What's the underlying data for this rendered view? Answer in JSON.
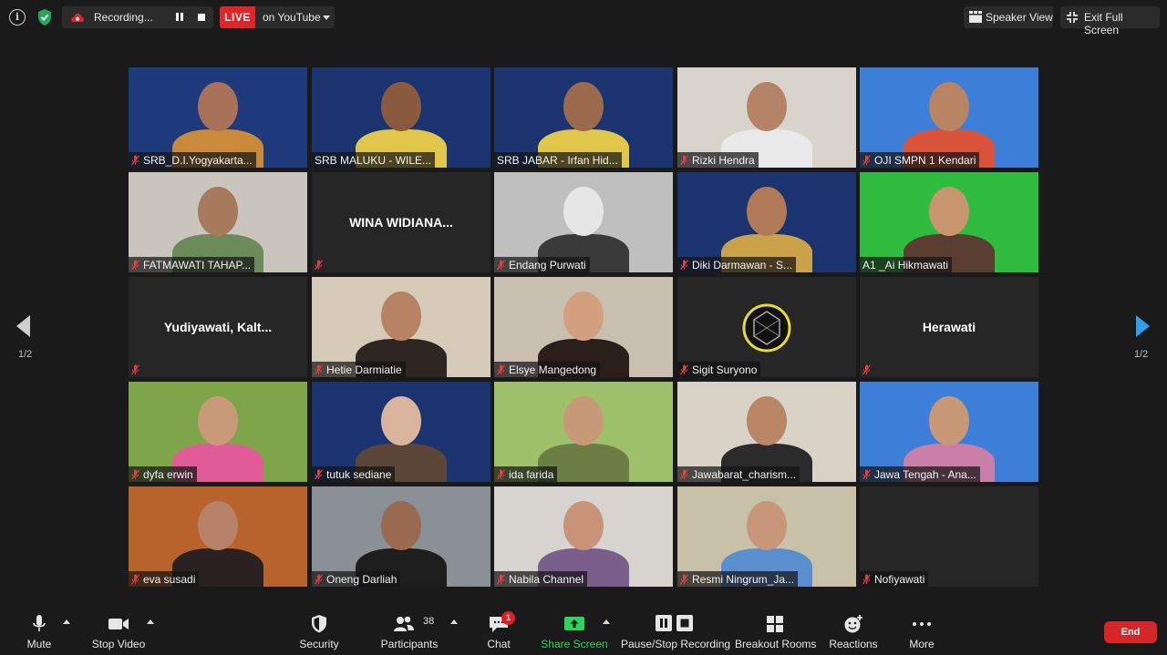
{
  "topbar": {
    "recording_label": "Recording...",
    "live_label": "LIVE",
    "stream_target": "on YouTube",
    "speaker_view_label": "Speaker View",
    "exit_fullscreen_label": "Exit Full Screen"
  },
  "pagination": {
    "left_indicator": "1/2",
    "right_indicator": "1/2"
  },
  "participants": [
    {
      "name": "SRB_D.I.Yogyakarta...",
      "type": "video",
      "bg": "#1e3a7a",
      "skin": "#a8725a",
      "shirt": "#c98a3b",
      "muted": true
    },
    {
      "name": "SRB MALUKU - WILE...",
      "type": "video",
      "bg": "#1b3470",
      "skin": "#8a5a3f",
      "shirt": "#e0c64a",
      "muted": false,
      "active": true
    },
    {
      "name": "SRB JABAR - Irfan Hid...",
      "type": "video",
      "bg": "#1b3470",
      "skin": "#9b6a4d",
      "shirt": "#e0c64a",
      "muted": false
    },
    {
      "name": "Rizki Hendra",
      "type": "video",
      "bg": "#d8d4cc",
      "skin": "#b58466",
      "shirt": "#e9e9ea",
      "muted": true
    },
    {
      "name": "OJI SMPN 1 Kendari",
      "type": "video",
      "bg": "#3d7fd8",
      "skin": "#b98464",
      "shirt": "#d9523a",
      "muted": true
    },
    {
      "name": "FATMAWATI TAHAP...",
      "type": "video",
      "bg": "#c9c5bd",
      "skin": "#a87a5d",
      "shirt": "#6c8a5a",
      "muted": true
    },
    {
      "name": "",
      "big_name": "WINA WIDIANA...",
      "type": "name",
      "muted": true
    },
    {
      "name": "Endang Purwati",
      "type": "video",
      "bg": "#bfbfbf",
      "skin": "#e6e6e6",
      "shirt": "#3a3a3a",
      "muted": true
    },
    {
      "name": "Diki Darmawan - S...",
      "type": "video",
      "bg": "#1b3470",
      "skin": "#b07a58",
      "shirt": "#c9a24a",
      "muted": true
    },
    {
      "name": "A1 _Ai Hikmawati",
      "type": "video",
      "bg": "#2fbb3e",
      "skin": "#c7966f",
      "shirt": "#5a3e31",
      "muted": false
    },
    {
      "name": "",
      "big_name": "Yudiyawati,  Kalt...",
      "type": "name",
      "muted": true
    },
    {
      "name": "Hetie Darmiatie",
      "type": "video",
      "bg": "#d6cbb8",
      "skin": "#b88264",
      "shirt": "#2e2622",
      "muted": true
    },
    {
      "name": "Elsye Mangedong",
      "type": "video",
      "bg": "#c8bfb0",
      "skin": "#d3a07f",
      "shirt": "#2a1f1a",
      "muted": true
    },
    {
      "name": "Sigit Suryono",
      "type": "avatar",
      "muted": true
    },
    {
      "name": "",
      "big_name": "Herawati",
      "type": "name",
      "muted": true
    },
    {
      "name": "dyfa erwin",
      "type": "video",
      "bg": "#7fa54a",
      "skin": "#c99a7a",
      "shirt": "#e05b98",
      "muted": true
    },
    {
      "name": "tutuk sediane",
      "type": "video",
      "bg": "#1b3470",
      "skin": "#d9b49c",
      "shirt": "#5b4638",
      "muted": true
    },
    {
      "name": "ida farida",
      "type": "video",
      "bg": "#9fc06a",
      "skin": "#c69a78",
      "shirt": "#6b7f45",
      "muted": true
    },
    {
      "name": "Jawabarat_charism...",
      "type": "video",
      "bg": "#d9d2c6",
      "skin": "#b98666",
      "shirt": "#2b2b2b",
      "muted": true
    },
    {
      "name": "Jawa Tengah - Ana...",
      "type": "video",
      "bg": "#3d7fd8",
      "skin": "#c99877",
      "shirt": "#c97fa8",
      "muted": true
    },
    {
      "name": "eva susadi",
      "type": "video",
      "bg": "#b8622c",
      "skin": "#b8826a",
      "shirt": "#2a2222",
      "muted": true
    },
    {
      "name": "Oneng Darliah",
      "type": "video",
      "bg": "#8b8f96",
      "skin": "#9a6a50",
      "shirt": "#1e1e1e",
      "muted": true
    },
    {
      "name": "Nabila Channel",
      "type": "video",
      "bg": "#d7d3ce",
      "skin": "#c79478",
      "shirt": "#7a5e8c",
      "muted": true
    },
    {
      "name": "Resmi Ningrum_Ja...",
      "type": "video",
      "bg": "#c9c0a8",
      "skin": "#c89678",
      "shirt": "#5a8fcf",
      "muted": true
    },
    {
      "name": "Nofiyawati",
      "type": "empty",
      "muted": true
    }
  ],
  "toolbar": {
    "mute": "Mute",
    "stop_video": "Stop Video",
    "security": "Security",
    "participants": "Participants",
    "participants_count": "38",
    "chat": "Chat",
    "chat_badge": "1",
    "share_screen": "Share Screen",
    "pause_stop_recording": "Pause/Stop Recording",
    "breakout_rooms": "Breakout Rooms",
    "reactions": "Reactions",
    "more": "More",
    "end": "End"
  },
  "colors": {
    "background": "#1a1a1a",
    "live_red": "#e0262a",
    "share_green": "#2bd45e",
    "active_speaker": "#dde26b",
    "nav_arrow_blue": "#2f9fea"
  }
}
